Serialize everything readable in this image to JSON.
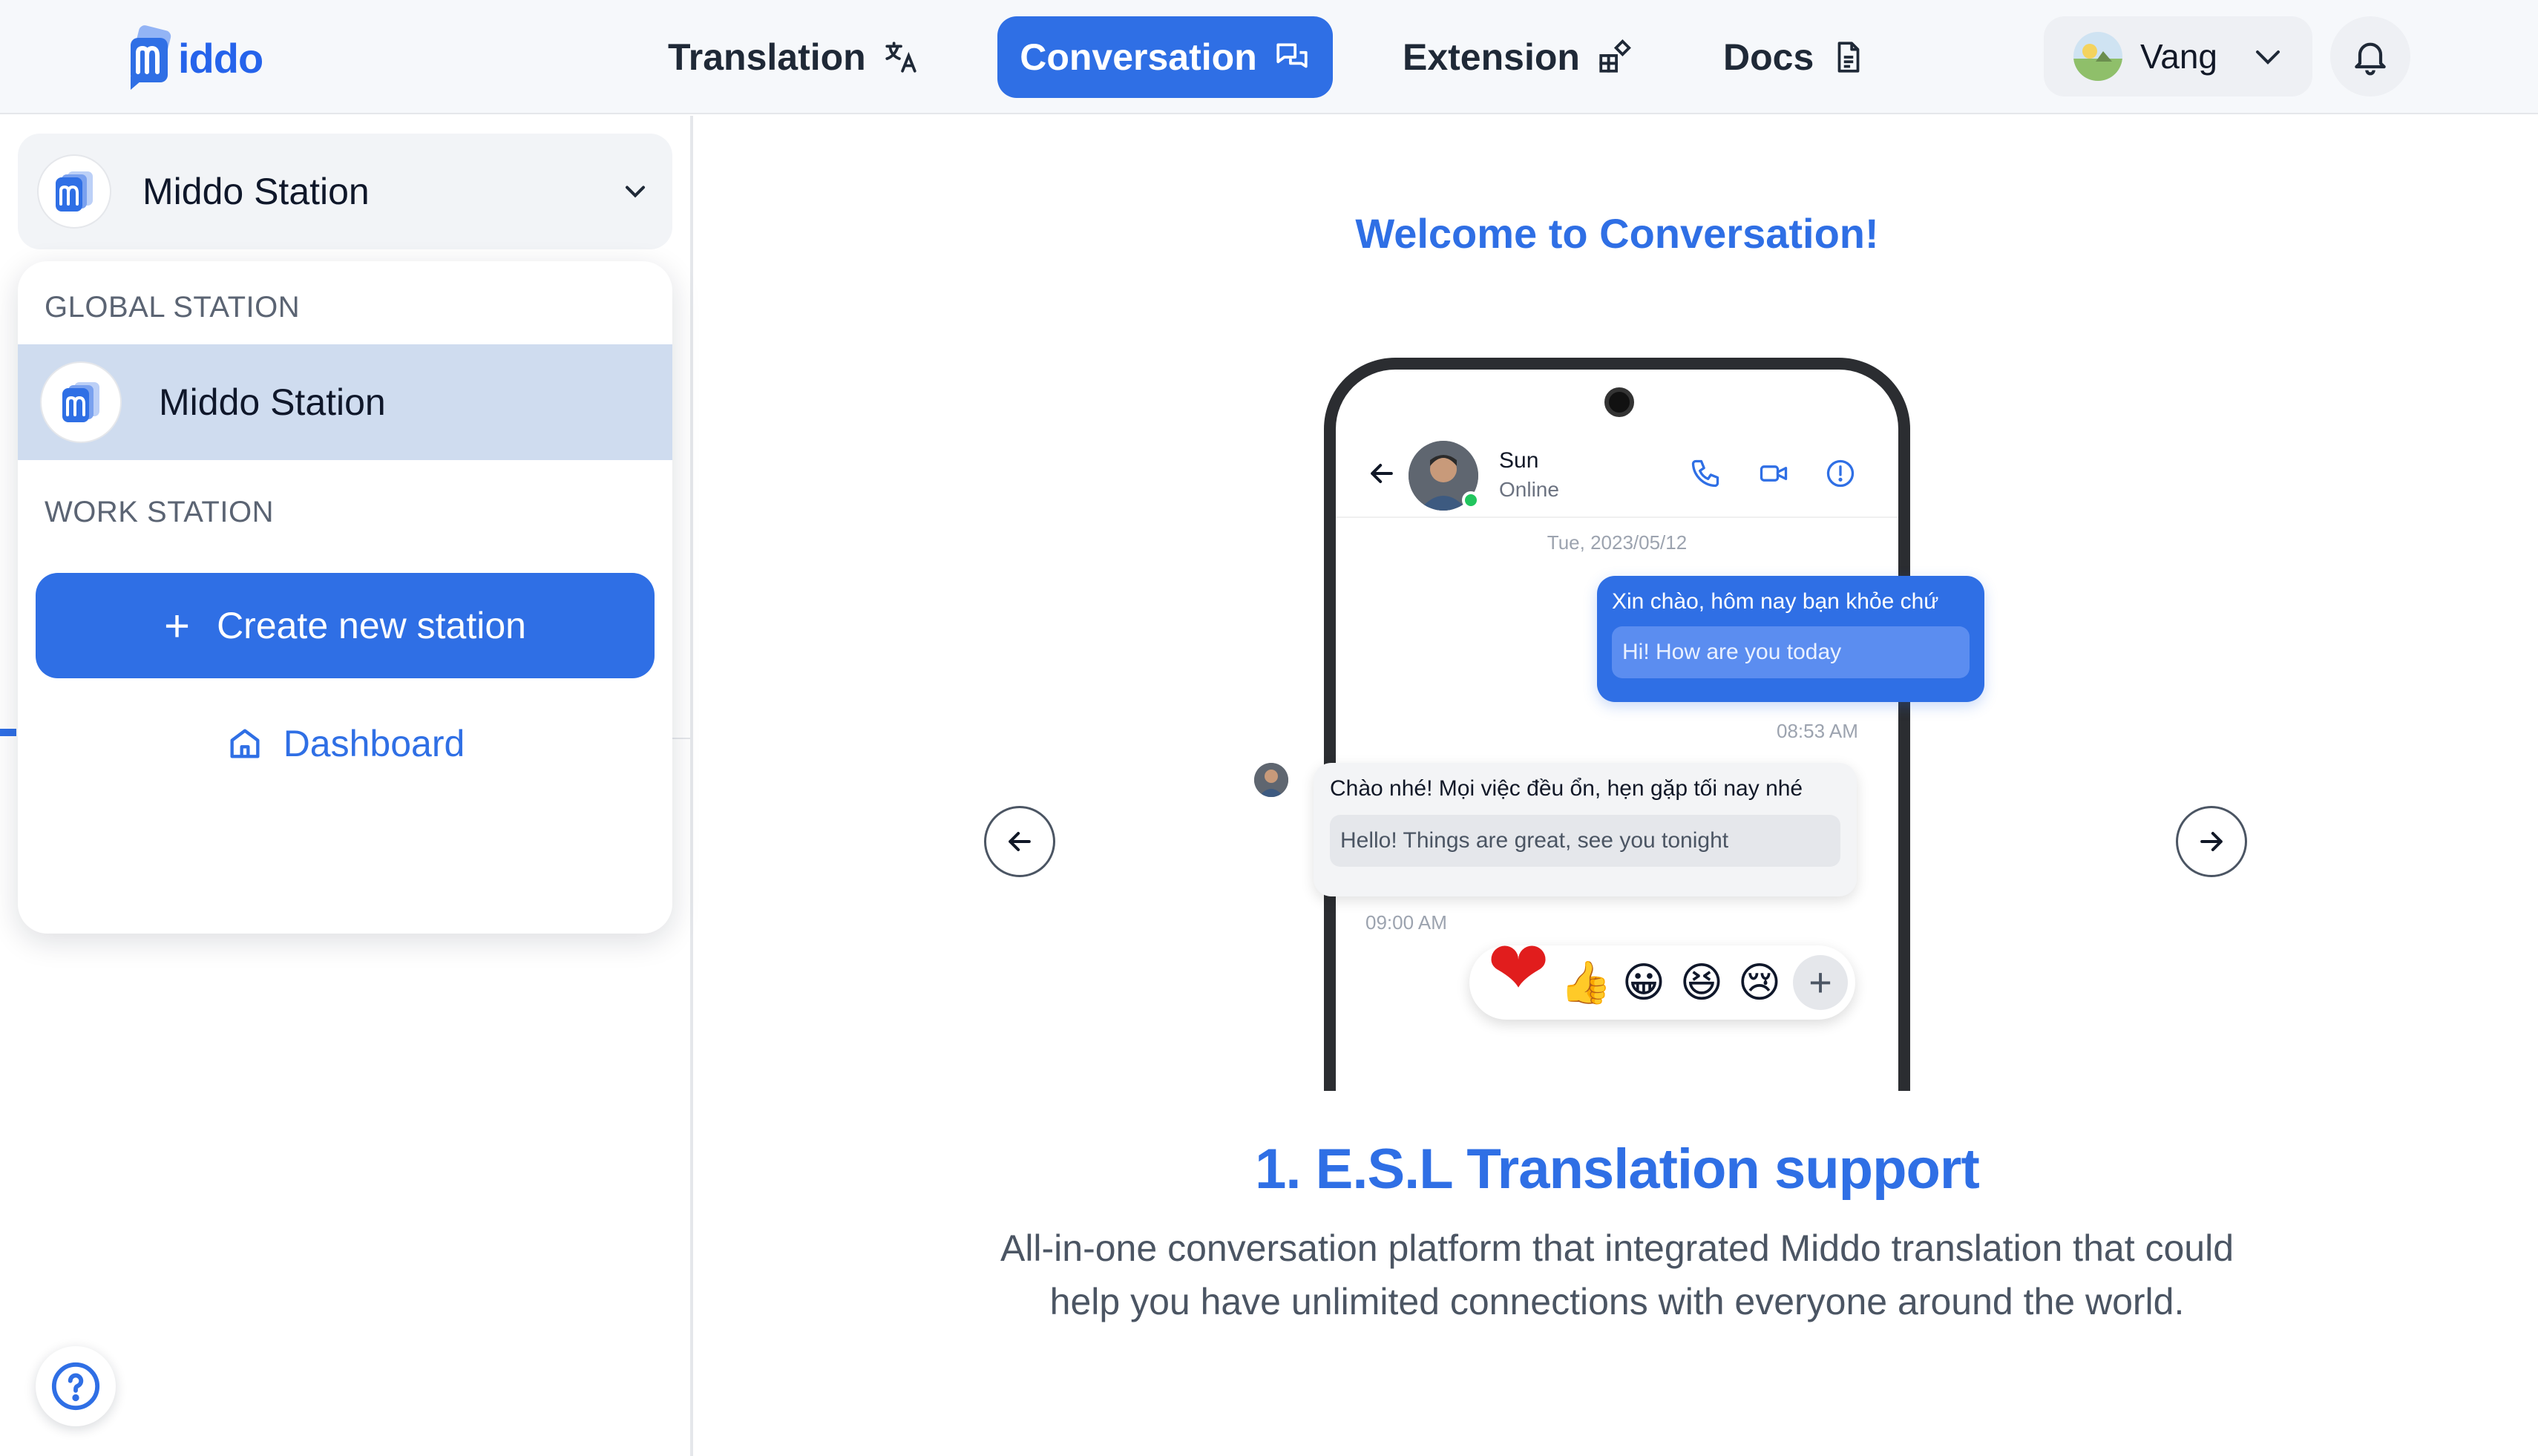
{
  "header": {
    "logo_text": "iddo",
    "nav": [
      {
        "label": "Translation",
        "icon": "translate-icon",
        "active": false
      },
      {
        "label": "Conversation",
        "icon": "chat-bubbles-icon",
        "active": true
      },
      {
        "label": "Extension",
        "icon": "extension-icon",
        "active": false
      },
      {
        "label": "Docs",
        "icon": "document-icon",
        "active": false
      }
    ],
    "user": {
      "name": "Vang"
    },
    "accent_color": "#2f6fe5"
  },
  "sidebar": {
    "current_station": "Middo Station",
    "dropdown": {
      "global_heading": "GLOBAL STATION",
      "global_items": [
        {
          "label": "Middo Station"
        }
      ],
      "work_heading": "WORK STATION",
      "create_label": "Create new station",
      "dashboard_label": "Dashboard"
    }
  },
  "main": {
    "welcome": "Welcome to Conversation!",
    "phone": {
      "contact_name": "Sun",
      "contact_status": "Online",
      "date": "Tue, 2023/05/12",
      "outgoing": {
        "original": "Xin chào, hôm nay bạn khỏe chứ",
        "translation": "Hi! How are you today",
        "time": "08:53 AM"
      },
      "incoming": {
        "original": "Chào nhé! Mọi việc đều ổn, hẹn gặp tối nay nhé",
        "translation": "Hello! Things are great, see you tonight",
        "time": "09:00 AM"
      },
      "reactions": [
        "❤",
        "👍",
        "😀",
        "😆",
        "😢"
      ]
    },
    "feature_title": "1. E.S.L Translation support",
    "feature_desc": "All-in-one conversation platform that integrated Middo translation that could help you have unlimited connections with everyone around the world."
  }
}
